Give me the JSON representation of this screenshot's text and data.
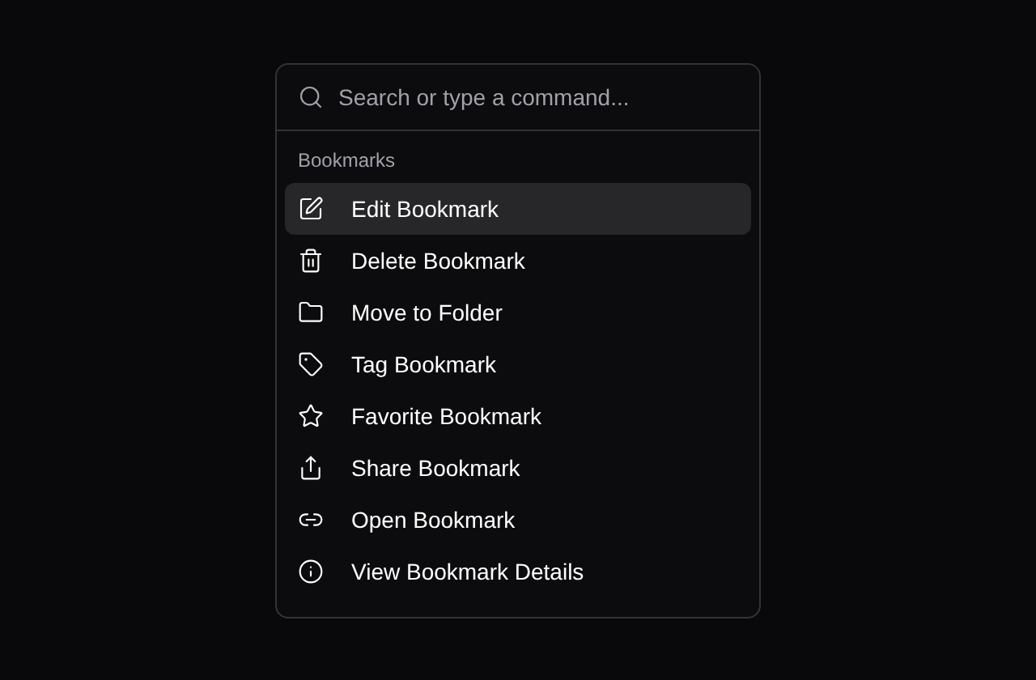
{
  "search": {
    "placeholder": "Search or type a command..."
  },
  "group": {
    "heading": "Bookmarks",
    "items": [
      {
        "label": "Edit Bookmark",
        "kind": "edit",
        "selected": true
      },
      {
        "label": "Delete Bookmark",
        "kind": "delete",
        "selected": false
      },
      {
        "label": "Move to Folder",
        "kind": "folder",
        "selected": false
      },
      {
        "label": "Tag Bookmark",
        "kind": "tag",
        "selected": false
      },
      {
        "label": "Favorite Bookmark",
        "kind": "favorite",
        "selected": false
      },
      {
        "label": "Share Bookmark",
        "kind": "share",
        "selected": false
      },
      {
        "label": "Open Bookmark",
        "kind": "link",
        "selected": false
      },
      {
        "label": "View Bookmark Details",
        "kind": "info",
        "selected": false
      }
    ]
  }
}
